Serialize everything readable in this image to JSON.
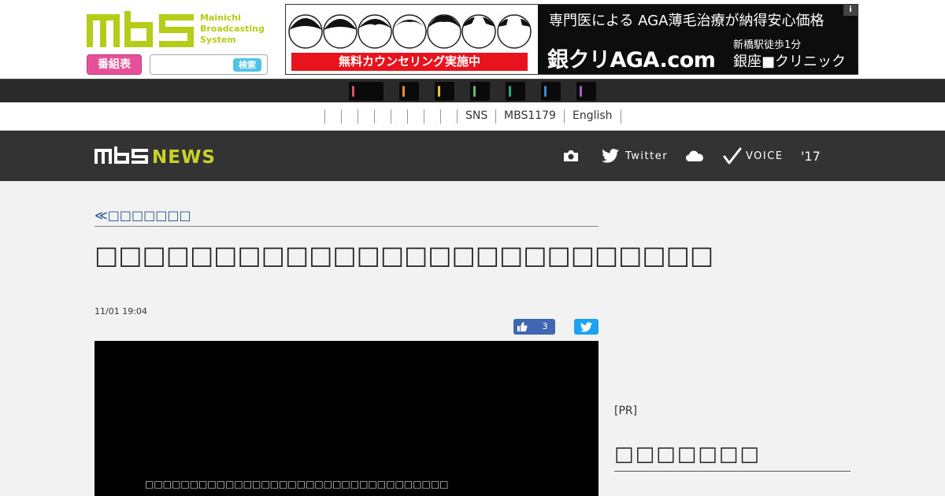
{
  "header": {
    "logo": {
      "wordmark": "MBS",
      "subtitle_lines": [
        "Mainichi",
        "Broadcasting",
        "System"
      ],
      "color": "#b5cc18"
    },
    "program_guide_label": "番組表",
    "program_guide_color": "#e7509a",
    "search": {
      "value": "",
      "button_label": "検索",
      "button_color": "#4fc3e8"
    }
  },
  "ad_banner": {
    "headline": "専門医による AGA薄毛治療が納得安心価格",
    "cta": "無料カウンセリング実施中",
    "brand": "銀クリAGA.com",
    "station": "新橋駅徒歩1分",
    "clinic": "銀座■クリニック",
    "info_badge": "i",
    "cta_color": "#e8131c"
  },
  "channel_strip": {
    "indicators": [
      {
        "name": "channel-1",
        "color": "#e0506a"
      },
      {
        "name": "channel-2",
        "color": "#f08a30"
      },
      {
        "name": "channel-3",
        "color": "#f0c030"
      },
      {
        "name": "channel-4",
        "color": "#5cbf5c"
      },
      {
        "name": "channel-5",
        "color": "#2aa87a"
      },
      {
        "name": "channel-6",
        "color": "#3a8ad0"
      },
      {
        "name": "channel-7",
        "color": "#a85cc8"
      }
    ]
  },
  "subnav": {
    "items": [
      "SNS",
      "MBS1179",
      "English"
    ]
  },
  "newsbar": {
    "logo_left": "MBS",
    "logo_right": "NEWS",
    "logo_right_color": "#c8d22a",
    "items": [
      {
        "icon": "camera-icon",
        "label": ""
      },
      {
        "icon": "twitter-icon",
        "label": "Twitter"
      },
      {
        "icon": "cloud-icon",
        "label": ""
      },
      {
        "icon": "checkmark-icon",
        "label": "VOICE"
      },
      {
        "icon": "seventeen-icon",
        "label": "'17"
      }
    ]
  },
  "article": {
    "back_link": "≪□□□□□□□",
    "headline": "□□□□□□□□□□□□□□□□□□□□□□□□□□",
    "datetime": "11/01 19:04",
    "like_count": "3",
    "video_caption": "□□□□□□□□□□□□□□□□□□□□□□□□□□□□□□□□□□"
  },
  "sidebar": {
    "pr_label": "[PR]",
    "heading": "□□□□□□□"
  }
}
